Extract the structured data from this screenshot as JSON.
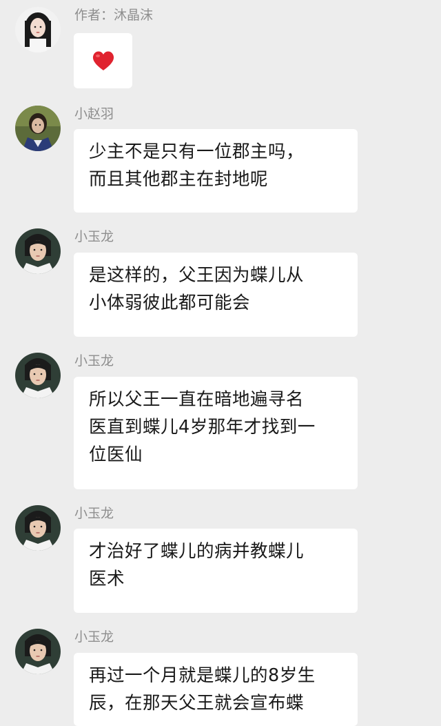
{
  "messages": [
    {
      "sender": "作者：沐晶沫",
      "avatar_icon": "female-portrait-avatar",
      "content_type": "emoji",
      "emoji": "heart-emoji"
    },
    {
      "sender": "小赵羽",
      "avatar_icon": "male-costume-avatar",
      "text": "少主不是只有一位郡主吗，\n而且其他郡主在封地呢"
    },
    {
      "sender": "小玉龙",
      "avatar_icon": "male-portrait-avatar",
      "text": "是这样的，父王因为蝶儿从\n小体弱彼此都可能会"
    },
    {
      "sender": "小玉龙",
      "avatar_icon": "male-portrait-avatar",
      "text": "所以父王一直在暗地遍寻名\n医直到蝶儿4岁那年才找到一\n位医仙"
    },
    {
      "sender": "小玉龙",
      "avatar_icon": "male-portrait-avatar",
      "text": "才治好了蝶儿的病并教蝶儿\n医术"
    },
    {
      "sender": "小玉龙",
      "avatar_icon": "male-portrait-avatar",
      "text": "再过一个月就是蝶儿的8岁生\n辰，在那天父王就会宣布蝶"
    }
  ],
  "colors": {
    "background": "#ededed",
    "bubble": "#ffffff",
    "sender_name": "#8e8e8e",
    "text": "#191919",
    "heart": "#e0232f"
  }
}
